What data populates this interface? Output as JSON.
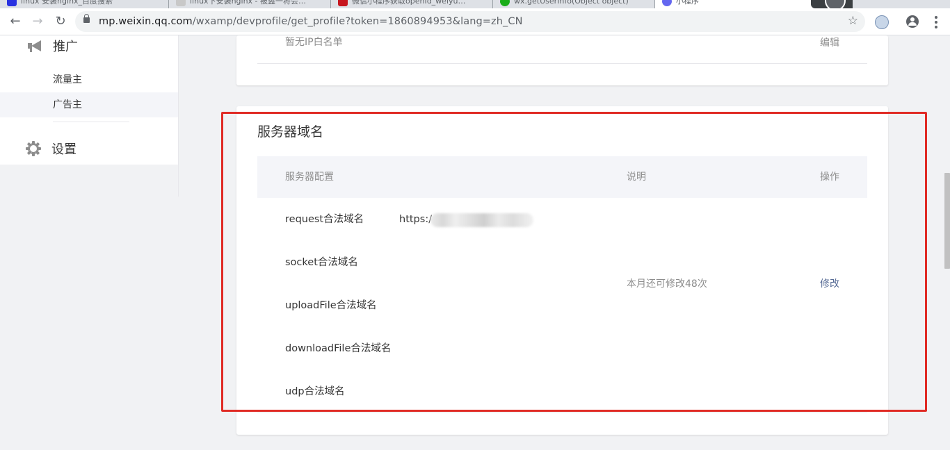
{
  "browser": {
    "tabs": [
      {
        "title": "linux 安装nginx_百度搜索",
        "favicon_color": "#2932e1"
      },
      {
        "title": "linux下安装nginx - 被盗一将会…",
        "favicon_color": "#c8c8c8"
      },
      {
        "title": "微信小程序获取openId_weiyu…",
        "favicon_color": "#c7161e"
      },
      {
        "title": "wx.getUserInfo(Object object)",
        "favicon_color": "#1aad19"
      },
      {
        "title": "小程序",
        "favicon_color": "#6467f0"
      }
    ],
    "url_host": "mp.weixin.qq.com",
    "url_rest": "/wxamp/devprofile/get_profile?token=1860894953&lang=zh_CN"
  },
  "sidebar": {
    "groups": [
      {
        "label": "推广",
        "icon": "megaphone-icon"
      },
      {
        "label": "设置",
        "icon": "gear-icon"
      }
    ],
    "subitems": [
      {
        "label": "流量主",
        "active": false
      },
      {
        "label": "广告主",
        "active": true
      }
    ]
  },
  "ip_section": {
    "empty_text": "暂无IP白名单",
    "edit_link": "编辑"
  },
  "server_domain": {
    "title": "服务器域名",
    "columns": [
      "服务器配置",
      "说明",
      "操作"
    ],
    "rows": [
      {
        "label": "request合法域名",
        "value": "https:/"
      },
      {
        "label": "socket合法域名",
        "value": ""
      },
      {
        "label": "uploadFile合法域名",
        "value": ""
      },
      {
        "label": "downloadFile合法域名",
        "value": ""
      },
      {
        "label": "udp合法域名",
        "value": ""
      }
    ],
    "description": "本月还可修改48次",
    "action": "修改"
  },
  "colors": {
    "link": "#576b95",
    "highlight": "#e02b25",
    "muted_text": "#8d8d8d"
  }
}
